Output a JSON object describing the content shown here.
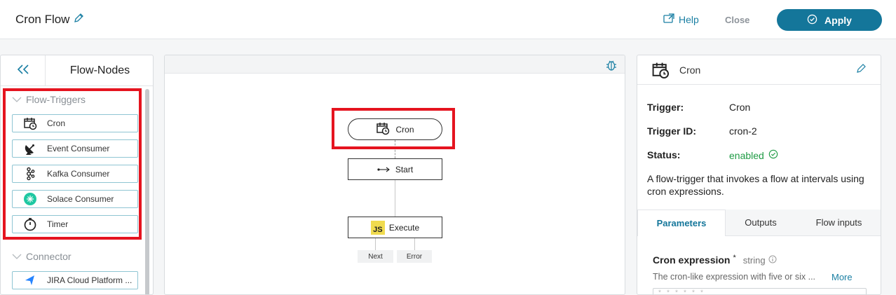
{
  "header": {
    "title": "Cron Flow",
    "help_label": "Help",
    "close_label": "Close",
    "apply_label": "Apply"
  },
  "left_panel": {
    "title": "Flow-Nodes",
    "groups": [
      {
        "label": "Flow-Triggers",
        "items": [
          {
            "label": "Cron",
            "icon": "calendar-clock-icon"
          },
          {
            "label": "Event Consumer",
            "icon": "satellite-dish-icon"
          },
          {
            "label": "Kafka Consumer",
            "icon": "kafka-icon"
          },
          {
            "label": "Solace Consumer",
            "icon": "solace-icon"
          },
          {
            "label": "Timer",
            "icon": "stopwatch-icon"
          }
        ]
      },
      {
        "label": "Connector",
        "items": [
          {
            "label": "JIRA Cloud Platform ...",
            "icon": "jira-icon"
          }
        ]
      }
    ]
  },
  "canvas": {
    "nodes": {
      "cron": "Cron",
      "start": "Start",
      "execute": "Execute",
      "execute_badge": "JS"
    },
    "outputs": {
      "next": "Next",
      "error": "Error"
    }
  },
  "right_panel": {
    "title": "Cron",
    "fields": [
      {
        "key": "Trigger:",
        "value": "Cron"
      },
      {
        "key": "Trigger ID:",
        "value": "cron-2"
      },
      {
        "key": "Status:",
        "value": "enabled"
      }
    ],
    "description": "A flow-trigger that invokes a flow at intervals using cron expressions.",
    "tabs": [
      "Parameters",
      "Outputs",
      "Flow inputs"
    ],
    "active_tab": "Parameters",
    "param": {
      "label": "Cron expression",
      "required_mark": "*",
      "type": "string",
      "help": "The cron-like expression with five or six ...",
      "more_label": "More",
      "input_placeholder": "* * * * * *"
    }
  },
  "colors": {
    "accent": "#14769a",
    "highlight": "#e5141f",
    "status_enabled": "#1f9b45"
  }
}
